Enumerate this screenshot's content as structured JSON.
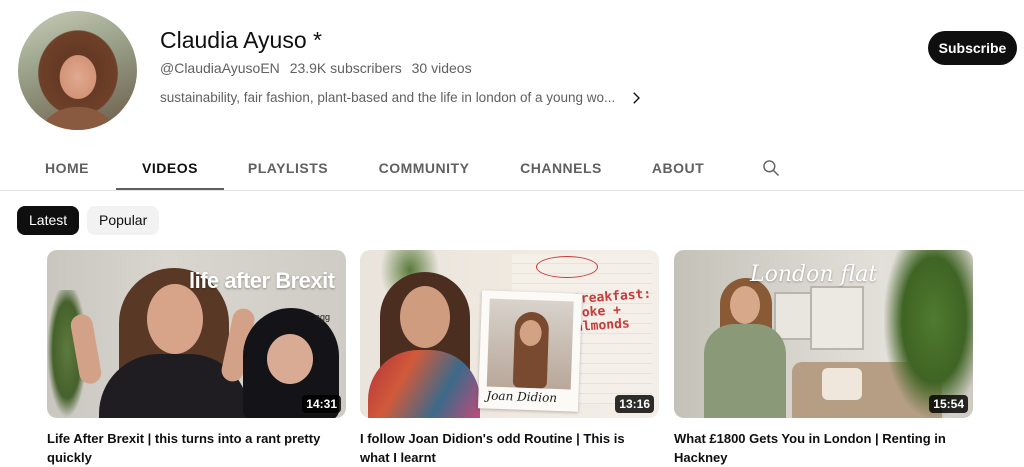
{
  "channel": {
    "name": "Claudia Ayuso *",
    "handle": "@ClaudiaAyusoEN",
    "subscribers": "23.9K subscribers",
    "videos": "30 videos",
    "description": "sustainability, fair fashion, plant-based and the life in london of a young wo...",
    "subscribe_label": "Subscribe"
  },
  "tabs": [
    {
      "label": "HOME"
    },
    {
      "label": "VIDEOS"
    },
    {
      "label": "PLAYLISTS"
    },
    {
      "label": "COMMUNITY"
    },
    {
      "label": "CHANNELS"
    },
    {
      "label": "ABOUT"
    }
  ],
  "active_tab": "VIDEOS",
  "chips": [
    {
      "label": "Latest"
    },
    {
      "label": "Popular"
    }
  ],
  "videos": [
    {
      "title": "Life After Brexit | this turns into a rant pretty quickly",
      "duration": "14:31",
      "thumb_text": "life after Brexit",
      "thumb_small": "agg"
    },
    {
      "title": "I follow Joan Didion's odd Routine | This is what I learnt",
      "duration": "13:16",
      "thumb_text": "Joan Didion",
      "thumb_note": "Breakfast: coke + almonds"
    },
    {
      "title": "What £1800 Gets You in London | Renting in Hackney",
      "duration": "15:54",
      "thumb_text": "London flat"
    }
  ],
  "icons": {
    "search": "search-icon",
    "chevron": "chevron-right-icon"
  },
  "colors": {
    "primary_text": "#0f0f0f",
    "secondary_text": "#606060",
    "button_bg": "#0f0f0f",
    "chip_inactive_bg": "#f2f2f2"
  }
}
